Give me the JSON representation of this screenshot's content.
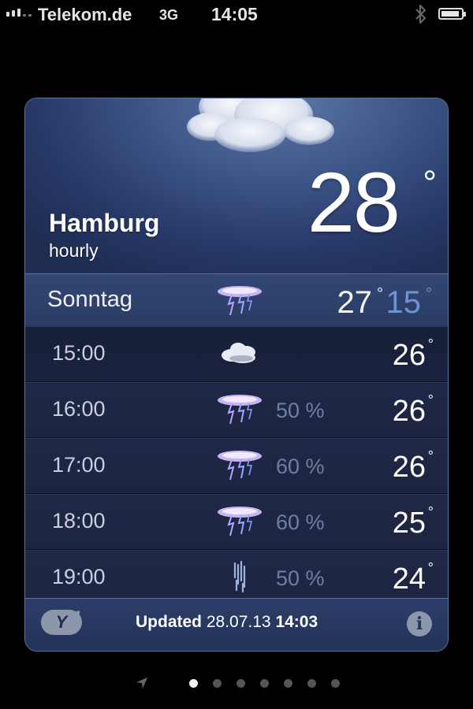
{
  "status_bar": {
    "carrier": "Telekom.de",
    "network": "3G",
    "time": "14:05",
    "icons": [
      "signal-icon",
      "bluetooth-icon",
      "battery-icon"
    ],
    "battery_level": 0.9
  },
  "weather": {
    "city": "Hamburg",
    "mode": "hourly",
    "current_temp": "28",
    "degree_symbol": "°",
    "day": {
      "label": "Sonntag",
      "icon": "thunderstorm-icon",
      "high": "27",
      "low": "15"
    },
    "hours": [
      {
        "time": "15:00",
        "icon": "cloudy-icon",
        "precip": "",
        "temp": "26"
      },
      {
        "time": "16:00",
        "icon": "thunderstorm-icon",
        "precip": "50 %",
        "temp": "26"
      },
      {
        "time": "17:00",
        "icon": "thunderstorm-icon",
        "precip": "60 %",
        "temp": "26"
      },
      {
        "time": "18:00",
        "icon": "thunderstorm-icon",
        "precip": "60 %",
        "temp": "25"
      },
      {
        "time": "19:00",
        "icon": "rain-icon",
        "precip": "50 %",
        "temp": "24"
      }
    ],
    "footer": {
      "updated_label": "Updated",
      "updated_date": "28.07.13",
      "updated_time": "14:03",
      "provider_icon": "yahoo-logo-icon",
      "info_icon": "info-icon"
    }
  },
  "pager": {
    "page_count": 7,
    "active_index": 0,
    "has_location_page": true
  },
  "colors": {
    "card_background": "#1b2440",
    "header_top": "#5b77a8",
    "low_temp": "#6d94d6",
    "precip_text": "#6f7fa3"
  }
}
